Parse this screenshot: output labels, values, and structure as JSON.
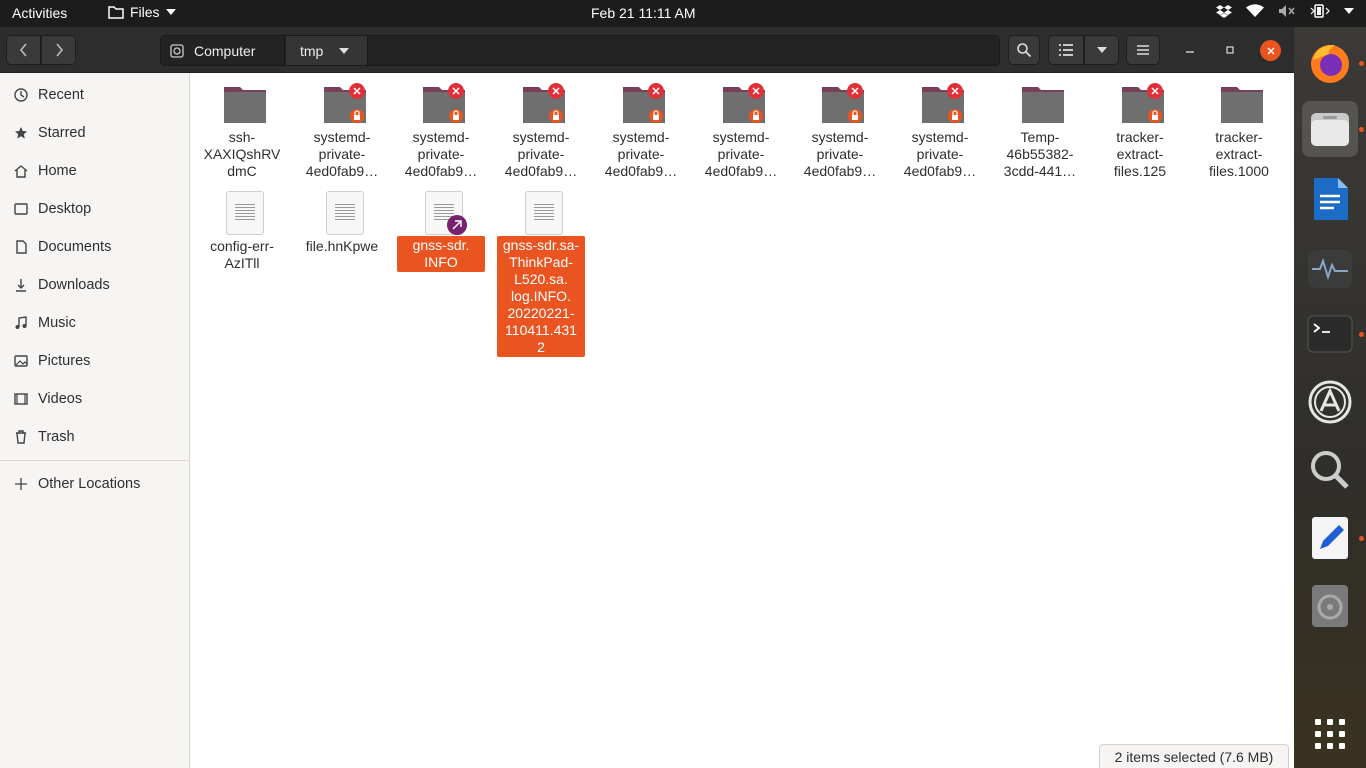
{
  "topbar": {
    "activities": "Activities",
    "app_name": "Files",
    "clock": "Feb 21  11:11 AM"
  },
  "pathbar": {
    "segments": [
      "Computer",
      "tmp"
    ]
  },
  "sidebar": {
    "items": [
      {
        "label": "Recent",
        "icon": "clock-icon"
      },
      {
        "label": "Starred",
        "icon": "star-icon"
      },
      {
        "label": "Home",
        "icon": "home-icon"
      },
      {
        "label": "Desktop",
        "icon": "desktop-icon"
      },
      {
        "label": "Documents",
        "icon": "document-icon"
      },
      {
        "label": "Downloads",
        "icon": "download-icon"
      },
      {
        "label": "Music",
        "icon": "music-icon"
      },
      {
        "label": "Pictures",
        "icon": "picture-icon"
      },
      {
        "label": "Videos",
        "icon": "video-icon"
      },
      {
        "label": "Trash",
        "icon": "trash-icon"
      }
    ],
    "other_locations": "Other Locations"
  },
  "files": [
    {
      "name": "ssh-\nXAXIQshRV\ndmC",
      "type": "folder",
      "locked": false
    },
    {
      "name": "systemd-\nprivate-\n4ed0fab9…",
      "type": "folder",
      "locked": true
    },
    {
      "name": "systemd-\nprivate-\n4ed0fab9…",
      "type": "folder",
      "locked": true
    },
    {
      "name": "systemd-\nprivate-\n4ed0fab9…",
      "type": "folder",
      "locked": true
    },
    {
      "name": "systemd-\nprivate-\n4ed0fab9…",
      "type": "folder",
      "locked": true
    },
    {
      "name": "systemd-\nprivate-\n4ed0fab9…",
      "type": "folder",
      "locked": true
    },
    {
      "name": "systemd-\nprivate-\n4ed0fab9…",
      "type": "folder",
      "locked": true
    },
    {
      "name": "systemd-\nprivate-\n4ed0fab9…",
      "type": "folder",
      "locked": true
    },
    {
      "name": "Temp-\n46b55382-\n3cdd-441…",
      "type": "folder",
      "locked": false
    },
    {
      "name": "tracker-\nextract-\nfiles.125",
      "type": "folder",
      "locked": true
    },
    {
      "name": "tracker-\nextract-\nfiles.1000",
      "type": "folder",
      "locked": false
    },
    {
      "name": "config-err-\nAzITll",
      "type": "file",
      "selected": false
    },
    {
      "name": "file.hnKpwe",
      "type": "file",
      "selected": false
    },
    {
      "name": "gnss-sdr.\nINFO",
      "type": "link",
      "selected": true
    },
    {
      "name": "gnss-sdr.sa-\nThinkPad-\nL520.sa.\nlog.INFO.\n20220221-\n110411.431\n2",
      "type": "file",
      "selected": true
    }
  ],
  "statusbar": "2 items selected (7.6 MB)",
  "colors": {
    "accent": "#e95420",
    "folder": "#6f6f6f",
    "folder_tab": "#7a3f5a",
    "lock_badge": "#e95420",
    "error_badge": "#e0303a"
  },
  "dock": {
    "apps": [
      "firefox-icon",
      "files-icon",
      "writer-icon",
      "system-monitor-icon",
      "terminal-icon",
      "software-center-icon",
      "search-icon",
      "text-editor-icon",
      "disc-icon",
      "show-apps-icon"
    ]
  }
}
